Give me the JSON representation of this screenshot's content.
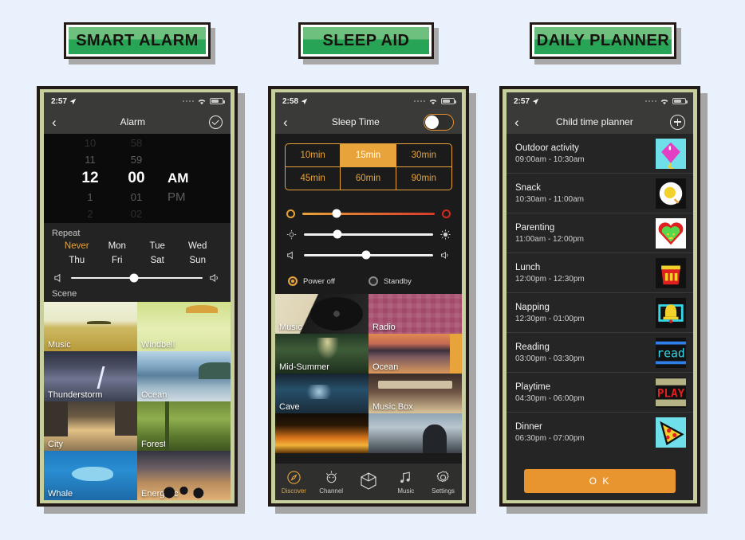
{
  "background_color": "#e9f1fc",
  "banners": [
    {
      "label": "SMART ALARM"
    },
    {
      "label": "SLEEP AID"
    },
    {
      "label": "DAILY PLANNER"
    }
  ],
  "phone1": {
    "status": {
      "time": "2:57",
      "location_icon": "location-arrow-icon",
      "wifi_icon": "wifi-icon",
      "battery_icon": "battery-icon"
    },
    "navbar": {
      "back_icon": "chevron-left-icon",
      "title": "Alarm",
      "confirm_icon": "check-circle-icon"
    },
    "picker": {
      "hours": [
        "10",
        "11",
        "12",
        "1",
        "2"
      ],
      "minutes": [
        "58",
        "59",
        "00",
        "01",
        "02"
      ],
      "selected_hour": "12",
      "selected_minute": "00",
      "meridiem": [
        "AM",
        "PM"
      ],
      "selected_meridiem": "AM"
    },
    "repeat": {
      "title": "Repeat",
      "days": [
        "Never",
        "Mon",
        "Tue",
        "Wed",
        "Thu",
        "Fri",
        "Sat",
        "Sun"
      ],
      "active": "Never",
      "active_color": "#e8a33a"
    },
    "volume": {
      "low_icon": "speaker-low-icon",
      "high_icon": "speaker-high-icon",
      "value_percent": 48
    },
    "scene": {
      "title": "Scene",
      "tiles": [
        {
          "label": "Music",
          "art": "art-music"
        },
        {
          "label": "Windbell",
          "art": "art-windbell"
        },
        {
          "label": "Thunderstorm",
          "art": "art-thunder"
        },
        {
          "label": "Ocean",
          "art": "art-ocean"
        },
        {
          "label": "City",
          "art": "art-city"
        },
        {
          "label": "Forest",
          "art": "art-forest"
        },
        {
          "label": "Whale",
          "art": "art-whale"
        },
        {
          "label": "Energetic",
          "art": "art-energetic"
        }
      ]
    }
  },
  "phone2": {
    "status": {
      "time": "2:58",
      "location_icon": "location-arrow-icon",
      "wifi_icon": "wifi-icon",
      "battery_icon": "battery-icon"
    },
    "navbar": {
      "back_icon": "chevron-left-icon",
      "title": "Sleep Time",
      "toggle_icon": "toggle-switch",
      "toggle_on": false
    },
    "durations": {
      "options": [
        "10min",
        "15min",
        "30min",
        "45min",
        "60min",
        "90min"
      ],
      "selected": "15min",
      "accent_color": "#e8a33a"
    },
    "sliders": [
      {
        "name": "color-temperature",
        "left_icon": "circle-outline-icon",
        "right_icon": "circle-outline-red-icon",
        "value_percent": 26
      },
      {
        "name": "brightness",
        "left_icon": "brightness-low-icon",
        "right_icon": "brightness-high-icon",
        "value_percent": 26
      },
      {
        "name": "volume",
        "left_icon": "speaker-low-icon",
        "right_icon": "speaker-high-icon",
        "value_percent": 48
      }
    ],
    "radios": [
      {
        "label": "Power off",
        "selected": true
      },
      {
        "label": "Standby",
        "selected": false
      }
    ],
    "media_tiles": [
      {
        "label": "Music",
        "art": "art-vinyl"
      },
      {
        "label": "Radio",
        "art": "art-radio"
      },
      {
        "label": "Mid-Summer",
        "art": "art-midsummer"
      },
      {
        "label": "Ocean",
        "art": "art-ocean2"
      },
      {
        "label": "Cave",
        "art": "art-cave"
      },
      {
        "label": "Music Box",
        "art": "art-musicbox"
      },
      {
        "label": "",
        "art": "art-fire"
      },
      {
        "label": "",
        "art": "art-sunset"
      }
    ],
    "tabbar": [
      {
        "label": "Discover",
        "icon": "compass-icon",
        "active": true
      },
      {
        "label": "Channel",
        "icon": "campfire-icon",
        "active": false
      },
      {
        "label": "",
        "icon": "hexagon-cube-icon",
        "active": false
      },
      {
        "label": "Music",
        "icon": "music-note-icon",
        "active": false
      },
      {
        "label": "Settings",
        "icon": "gear-icon",
        "active": false
      }
    ]
  },
  "phone3": {
    "status": {
      "time": "2:57",
      "location_icon": "location-arrow-icon",
      "wifi_icon": "wifi-icon",
      "battery_icon": "battery-icon"
    },
    "navbar": {
      "back_icon": "chevron-left-icon",
      "title": "Child time planner",
      "add_icon": "plus-circle-icon"
    },
    "items": [
      {
        "title": "Outdoor activity",
        "time": "09:00am - 10:30am",
        "icon": "kite-icon"
      },
      {
        "title": "Snack",
        "time": "10:30am - 11:00am",
        "icon": "fried-egg-icon"
      },
      {
        "title": "Parenting",
        "time": "11:00am - 12:00pm",
        "icon": "heart-icon"
      },
      {
        "title": "Lunch",
        "time": "12:00pm - 12:30pm",
        "icon": "fries-icon"
      },
      {
        "title": "Napping",
        "time": "12:30pm - 01:00pm",
        "icon": "bell-icon"
      },
      {
        "title": "Reading",
        "time": "03:00pm - 03:30pm",
        "icon": "read-icon"
      },
      {
        "title": "Playtime",
        "time": "04:30pm - 06:00pm",
        "icon": "play-icon"
      },
      {
        "title": "Dinner",
        "time": "06:30pm - 07:00pm",
        "icon": "pizza-icon"
      }
    ],
    "ok_button": {
      "label": "O K",
      "color": "#e8952f"
    }
  }
}
